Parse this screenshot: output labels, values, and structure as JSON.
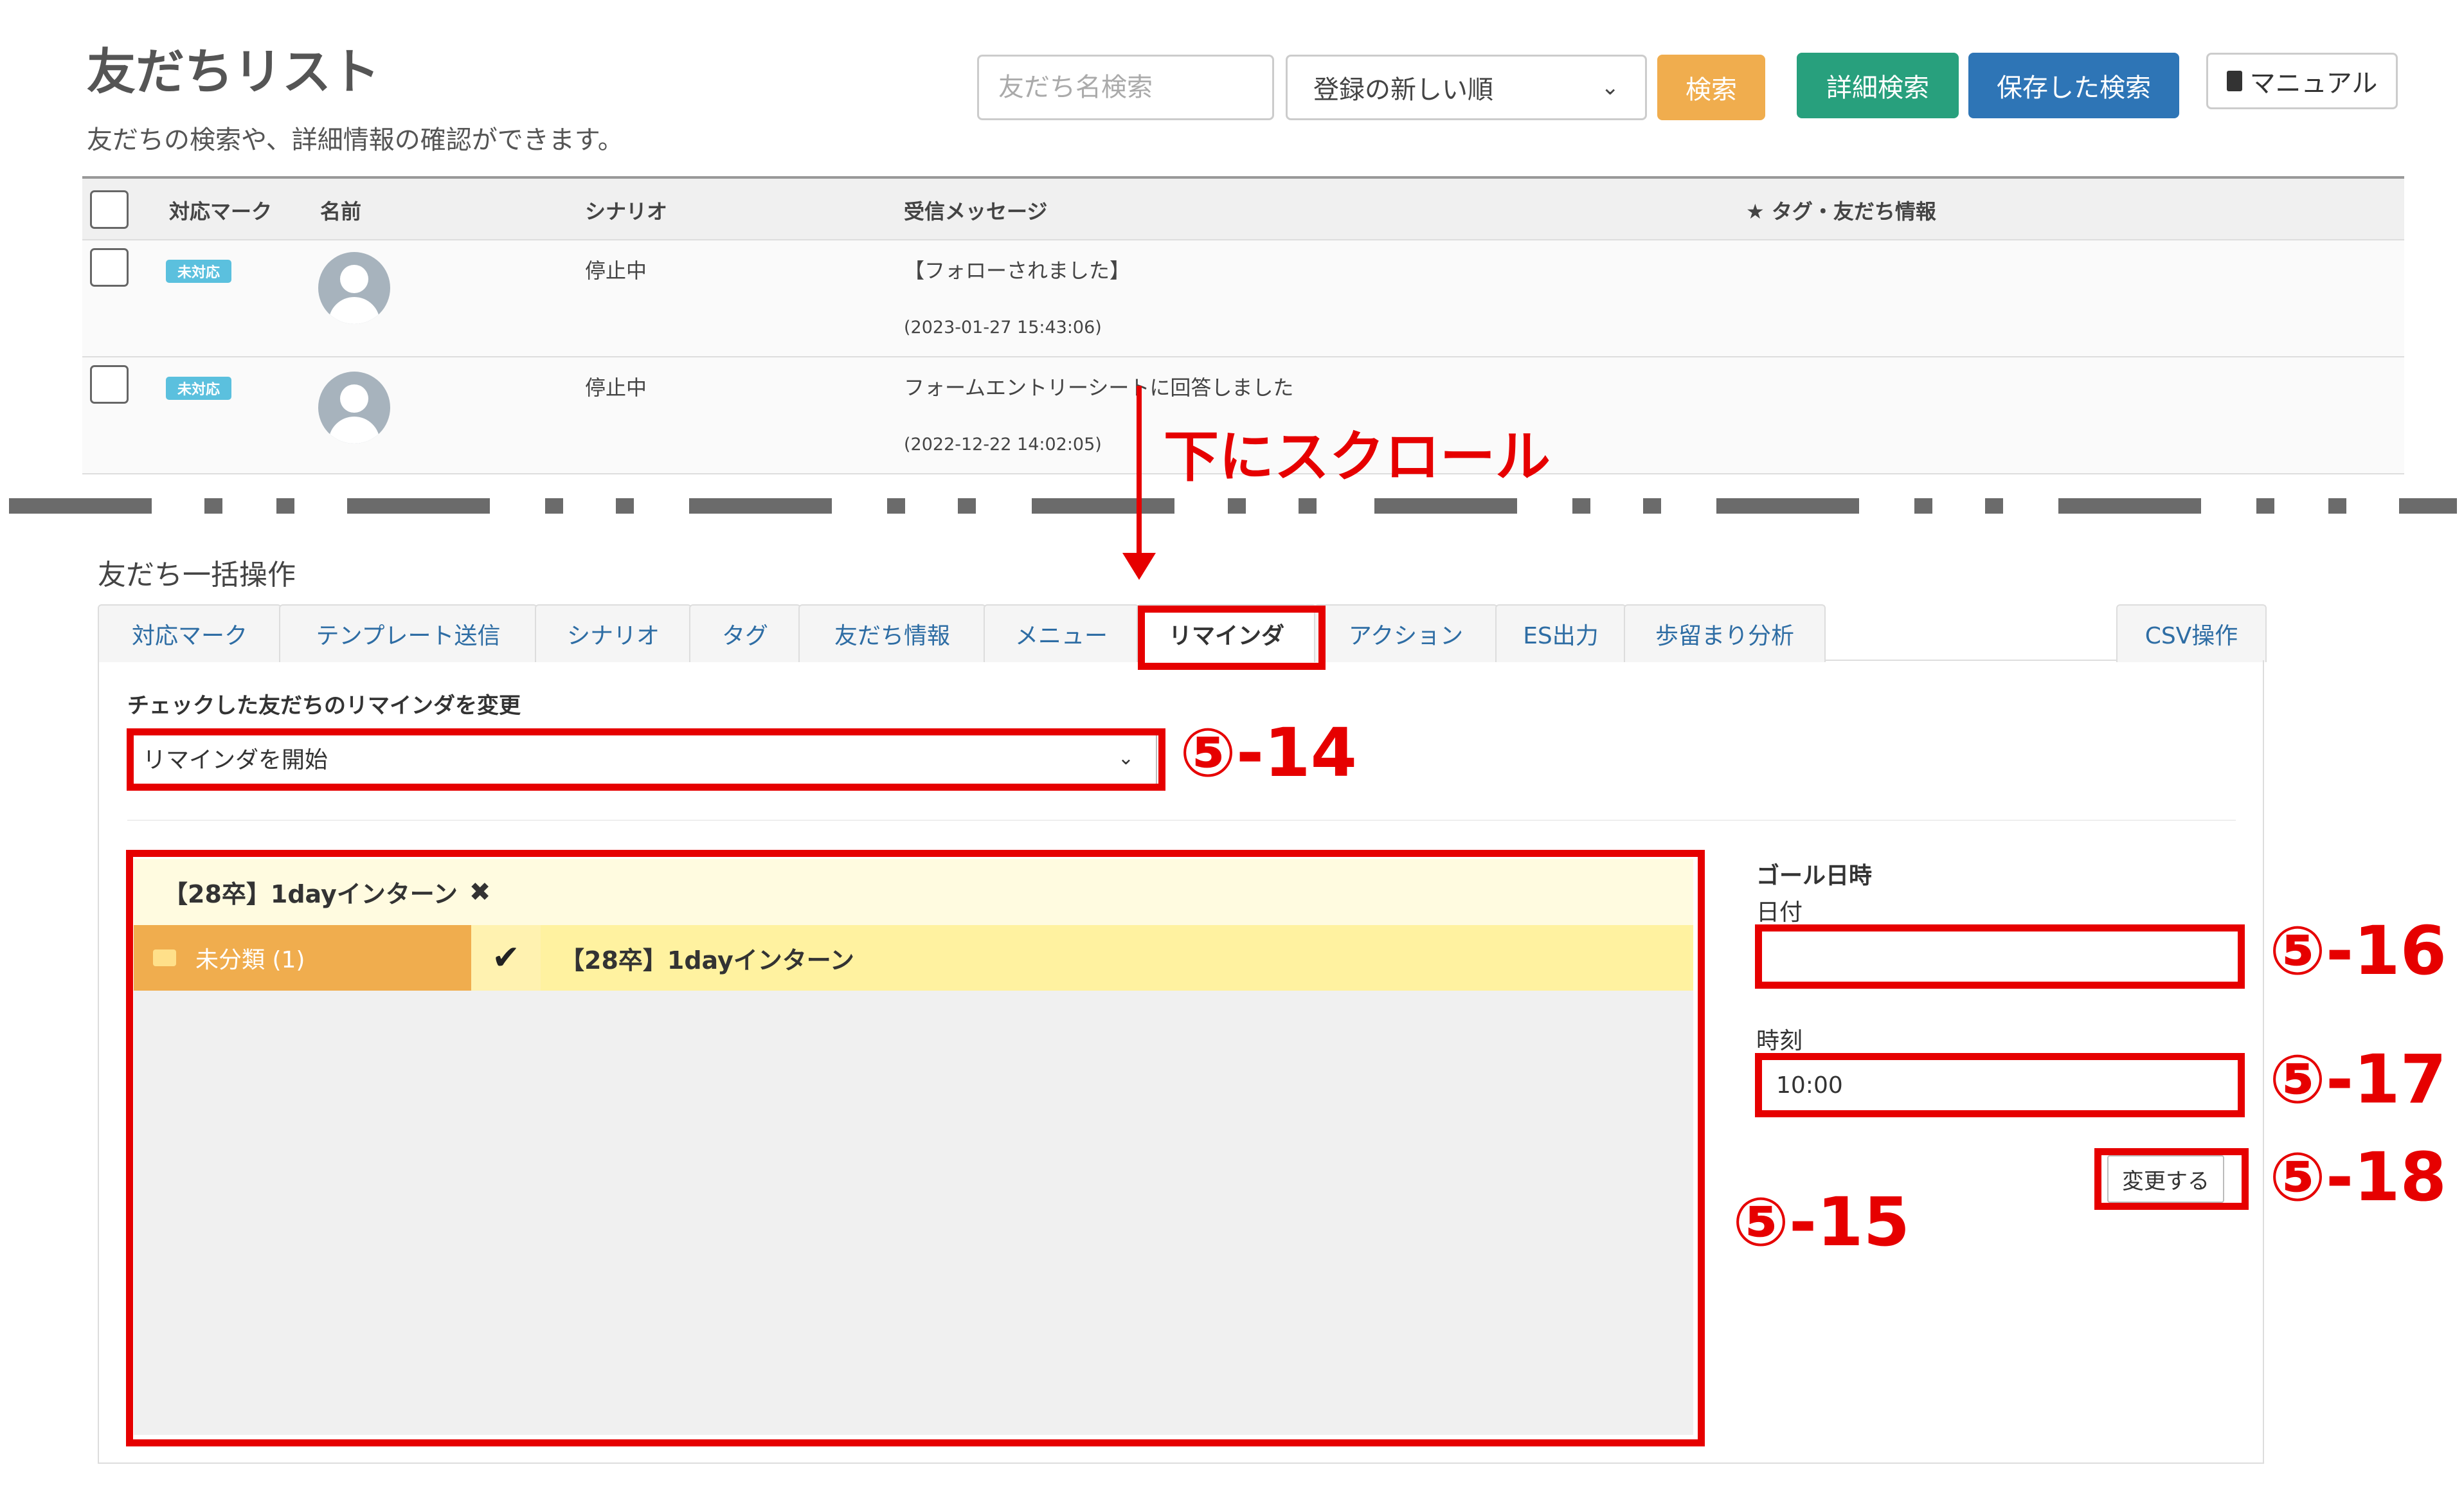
{
  "header": {
    "title": "友だちリスト",
    "subtitle": "友だちの検索や、詳細情報の確認ができます。"
  },
  "search": {
    "placeholder": "友だち名検索",
    "sort_selected": "登録の新しい順",
    "search_label": "検索",
    "detail_label": "詳細検索",
    "saved_label": "保存した検索",
    "manual_label": "マニュアル"
  },
  "table": {
    "columns": [
      "対応マーク",
      "名前",
      "シナリオ",
      "受信メッセージ",
      "★ タグ・友だち情報"
    ],
    "rows": [
      {
        "mark": "未対応",
        "scenario": "停止中",
        "message": "【フォローされました】",
        "time": "(2023-01-27 15:43:06)"
      },
      {
        "mark": "未対応",
        "scenario": "停止中",
        "message": "フォームエントリーシートに回答しました",
        "time": "(2022-12-22 14:02:05)"
      }
    ]
  },
  "annotation": {
    "scroll": "下にスクロール",
    "labels": [
      "⑤-14",
      "⑤-15",
      "⑤-16",
      "⑤-17",
      "⑤-18"
    ],
    "color": "#e60000"
  },
  "bulk": {
    "title": "友だち一括操作",
    "tabs": [
      "対応マーク",
      "テンプレート送信",
      "シナリオ",
      "タグ",
      "友だち情報",
      "メニュー",
      "リマインダ",
      "アクション",
      "ES出力",
      "歩留まり分析",
      "CSV操作"
    ],
    "active_tab": "リマインダ",
    "reminder_label": "チェックした友だちのリマインダを変更",
    "reminder_selected": "リマインダを開始",
    "selected_reminder": "【28卒】1dayインターン",
    "folder": "未分類 (1)",
    "item": "【28卒】1dayインターン",
    "goal_title": "ゴール日時",
    "date_label": "日付",
    "date_value": "",
    "time_label": "時刻",
    "time_value": "10:00",
    "change_button": "変更する"
  }
}
